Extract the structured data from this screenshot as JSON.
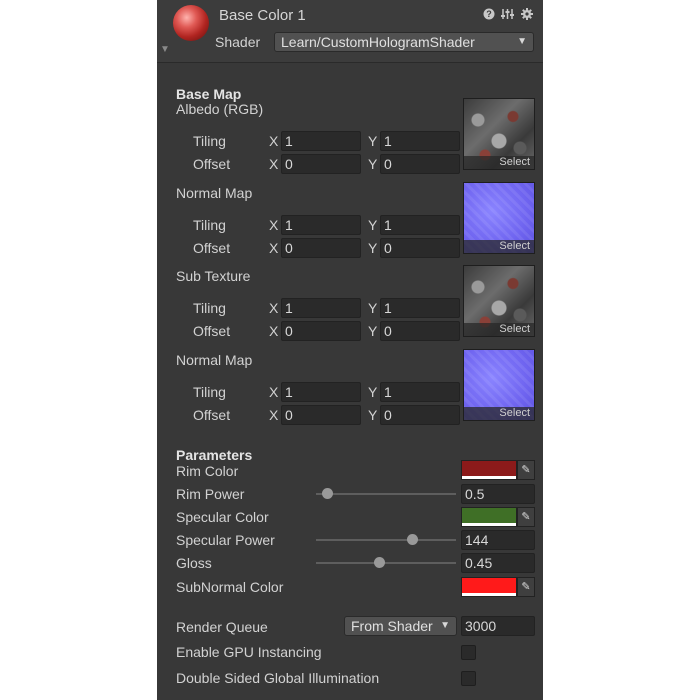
{
  "header": {
    "title": "Base Color 1",
    "shader_label": "Shader",
    "shader_value": "Learn/CustomHologramShader",
    "icons": [
      "help-icon",
      "preset-icon",
      "settings-gear-icon"
    ]
  },
  "base_map": {
    "title": "Base Map",
    "albedo_label": "Albedo (RGB)",
    "tiling_label": "Tiling",
    "offset_label": "Offset",
    "x_label": "X",
    "y_label": "Y",
    "tiling_x": "1",
    "tiling_y": "1",
    "offset_x": "0",
    "offset_y": "0",
    "select": "Select"
  },
  "normal_map_1": {
    "label": "Normal Map",
    "tiling_label": "Tiling",
    "offset_label": "Offset",
    "x_label": "X",
    "y_label": "Y",
    "tiling_x": "1",
    "tiling_y": "1",
    "offset_x": "0",
    "offset_y": "0",
    "select": "Select"
  },
  "sub_texture": {
    "label": "Sub Texture",
    "tiling_label": "Tiling",
    "offset_label": "Offset",
    "x_label": "X",
    "y_label": "Y",
    "tiling_x": "1",
    "tiling_y": "1",
    "offset_x": "0",
    "offset_y": "0",
    "select": "Select"
  },
  "normal_map_2": {
    "label": "Normal Map",
    "tiling_label": "Tiling",
    "offset_label": "Offset",
    "x_label": "X",
    "y_label": "Y",
    "tiling_x": "1",
    "tiling_y": "1",
    "offset_x": "0",
    "offset_y": "0",
    "select": "Select"
  },
  "parameters": {
    "title": "Parameters",
    "rim_color_label": "Rim Color",
    "rim_color": "#8c1a1a",
    "rim_power_label": "Rim Power",
    "rim_power_value": "0.5",
    "rim_power_fraction": 0.08,
    "specular_color_label": "Specular Color",
    "specular_color": "#3f6f26",
    "specular_power_label": "Specular Power",
    "specular_power_value": "144",
    "specular_power_fraction": 0.69,
    "gloss_label": "Gloss",
    "gloss_value": "0.45",
    "gloss_fraction": 0.45,
    "subnormal_color_label": "SubNormal Color",
    "subnormal_color": "#ff1a1a",
    "picker_icon": "eyedropper-icon"
  },
  "footer": {
    "render_queue_label": "Render Queue",
    "render_queue_mode": "From Shader",
    "render_queue_value": "3000",
    "gpu_instancing_label": "Enable GPU Instancing",
    "gpu_instancing_checked": false,
    "double_sided_gi_label": "Double Sided Global Illumination",
    "double_sided_gi_checked": false
  }
}
